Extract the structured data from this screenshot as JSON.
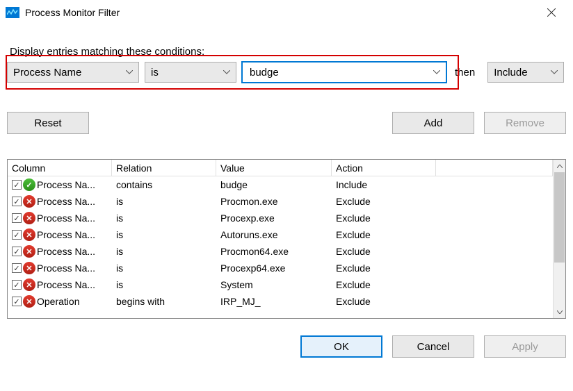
{
  "title": "Process Monitor Filter",
  "prompt": "Display entries matching these conditions:",
  "filter": {
    "column": "Process Name",
    "relation": "is",
    "value": "budge",
    "then_label": "then",
    "action": "Include"
  },
  "buttons": {
    "reset": "Reset",
    "add": "Add",
    "remove": "Remove",
    "ok": "OK",
    "cancel": "Cancel",
    "apply": "Apply"
  },
  "headers": {
    "column": "Column",
    "relation": "Relation",
    "value": "Value",
    "action": "Action"
  },
  "rows": [
    {
      "status": "include",
      "column": "Process Na...",
      "relation": "contains",
      "value": "budge",
      "action": "Include"
    },
    {
      "status": "exclude",
      "column": "Process Na...",
      "relation": "is",
      "value": "Procmon.exe",
      "action": "Exclude"
    },
    {
      "status": "exclude",
      "column": "Process Na...",
      "relation": "is",
      "value": "Procexp.exe",
      "action": "Exclude"
    },
    {
      "status": "exclude",
      "column": "Process Na...",
      "relation": "is",
      "value": "Autoruns.exe",
      "action": "Exclude"
    },
    {
      "status": "exclude",
      "column": "Process Na...",
      "relation": "is",
      "value": "Procmon64.exe",
      "action": "Exclude"
    },
    {
      "status": "exclude",
      "column": "Process Na...",
      "relation": "is",
      "value": "Procexp64.exe",
      "action": "Exclude"
    },
    {
      "status": "exclude",
      "column": "Process Na...",
      "relation": "is",
      "value": "System",
      "action": "Exclude"
    },
    {
      "status": "exclude",
      "column": "Operation",
      "relation": "begins with",
      "value": "IRP_MJ_",
      "action": "Exclude"
    }
  ]
}
